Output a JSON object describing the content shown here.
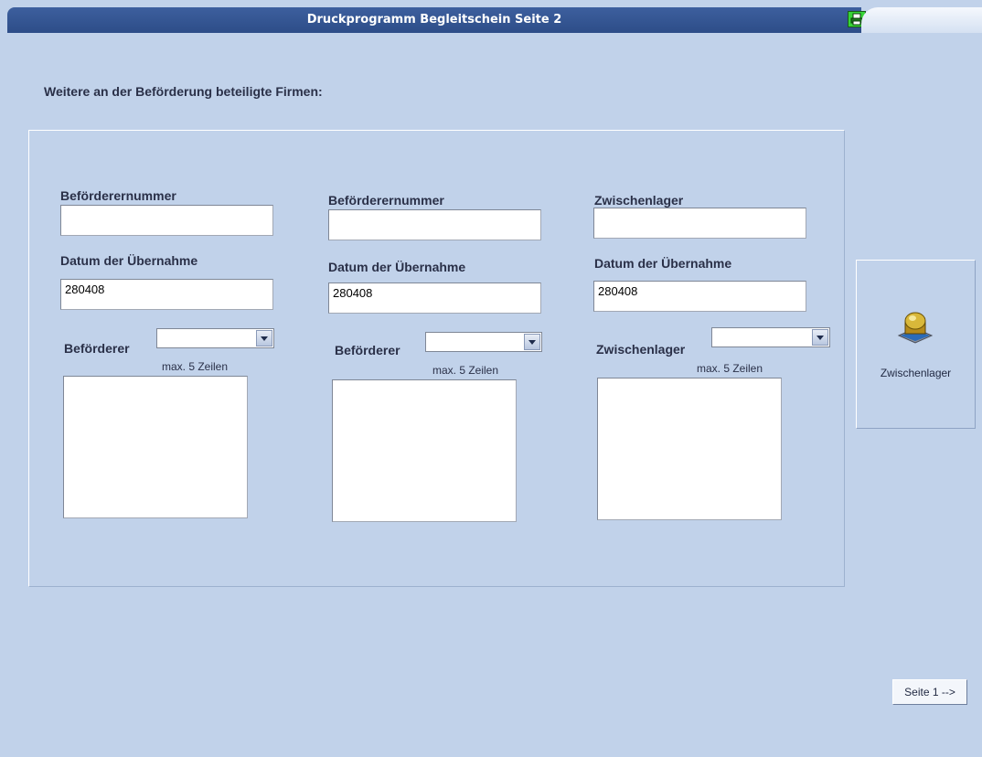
{
  "window": {
    "title": "Druckprogramm Begleitschein Seite 2",
    "print_icon": "printer-icon"
  },
  "heading": "Weitere an der Beförderung beteiligte Firmen:",
  "columns": [
    {
      "number_label": "Beförderernummer",
      "number_value": "",
      "date_label": "Datum der Übernahme",
      "date_value": "280408",
      "select_label": "Beförderer",
      "select_value": "",
      "hint": "max. 5 Zeilen",
      "textarea_value": ""
    },
    {
      "number_label": "Beförderernummer",
      "number_value": "",
      "date_label": "Datum der Übernahme",
      "date_value": "280408",
      "select_label": "Beförderer",
      "select_value": "",
      "hint": "max. 5 Zeilen",
      "textarea_value": ""
    },
    {
      "number_label": "Zwischenlager",
      "number_value": "",
      "date_label": "Datum der Übernahme",
      "date_value": "280408",
      "select_label": "Zwischenlager",
      "select_value": "",
      "hint": "max. 5 Zeilen",
      "textarea_value": ""
    }
  ],
  "side_button": {
    "label": "Zwischenlager",
    "icon": "storage-tank-icon"
  },
  "nav_button": {
    "label": "Seite 1 -->"
  },
  "colors": {
    "background": "#c1d2ea",
    "titlebar": "#2d4d88",
    "printer_icon": "#37d437"
  }
}
